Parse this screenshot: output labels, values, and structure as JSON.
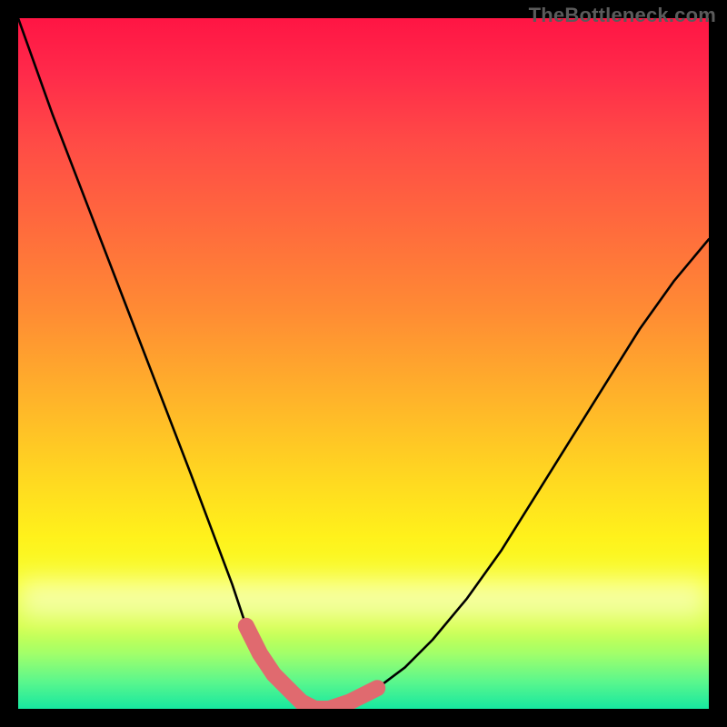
{
  "watermark": {
    "text": "TheBottleneck.com"
  },
  "chart_data": {
    "type": "line",
    "title": "",
    "xlabel": "",
    "ylabel": "",
    "xlim": [
      0,
      100
    ],
    "ylim": [
      0,
      100
    ],
    "grid": false,
    "series": [
      {
        "name": "bottleneck-curve",
        "color": "#000000",
        "x": [
          0,
          5,
          10,
          15,
          20,
          25,
          28,
          31,
          33,
          35,
          37,
          39,
          41,
          43,
          45,
          48,
          52,
          56,
          60,
          65,
          70,
          75,
          80,
          85,
          90,
          95,
          100
        ],
        "values": [
          100,
          86,
          73,
          60,
          47,
          34,
          26,
          18,
          12,
          8,
          5,
          3,
          1,
          0,
          0,
          1,
          3,
          6,
          10,
          16,
          23,
          31,
          39,
          47,
          55,
          62,
          68
        ]
      }
    ],
    "highlight": {
      "name": "optimal-range",
      "color": "#e06a6f",
      "x_start": 33,
      "x_end": 52,
      "segment": [
        {
          "x": 33,
          "y": 12
        },
        {
          "x": 35,
          "y": 8
        },
        {
          "x": 37,
          "y": 5
        },
        {
          "x": 39,
          "y": 3
        },
        {
          "x": 41,
          "y": 1
        },
        {
          "x": 43,
          "y": 0
        },
        {
          "x": 45,
          "y": 0
        },
        {
          "x": 48,
          "y": 1
        },
        {
          "x": 52,
          "y": 3
        }
      ]
    },
    "background_gradient": {
      "top": "#ff1544",
      "upper_mid": "#ffb32a",
      "lower_mid": "#fff11b",
      "bottom": "#16e8a0"
    }
  }
}
